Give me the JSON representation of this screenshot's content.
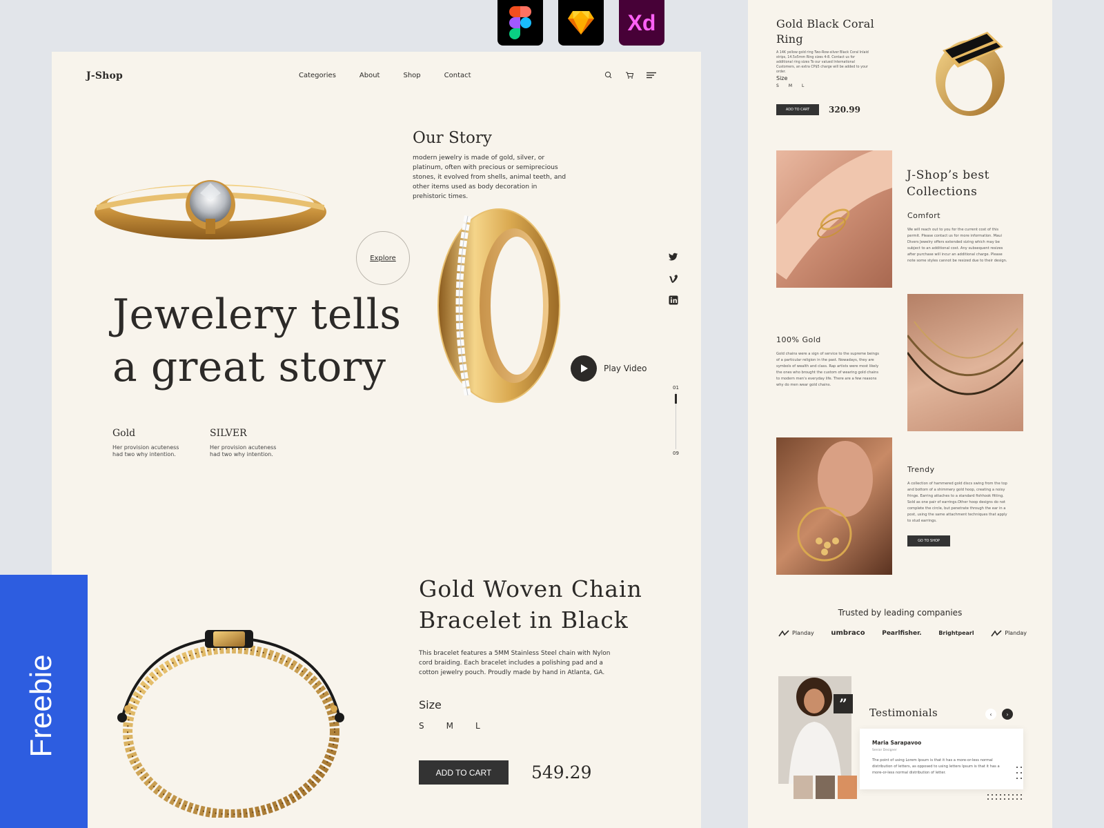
{
  "tools": {
    "xd_label": "Xd"
  },
  "freebie": {
    "label": "Freebie"
  },
  "nav": {
    "logo": "J-Shop",
    "links": [
      "Categories",
      "About",
      "Shop",
      "Contact"
    ],
    "icons": [
      "search-icon",
      "cart-icon",
      "menu-icon"
    ]
  },
  "hero": {
    "story_title": "Our Story",
    "story_text": "modern jewelry is made of gold, silver, or platinum, often with precious or semiprecious stones, it evolved from shells, animal teeth, and other items used as body decoration in prehistoric times.",
    "explore_label": "Explore",
    "title_line1": "Jewelery tells",
    "title_line2": "a great story",
    "materials": [
      {
        "title": "Gold",
        "text": "Her provision acuteness had two why intention."
      },
      {
        "title": "SILVER",
        "text": "Her provision acuteness had two why intention."
      }
    ],
    "play_label": "Play Video",
    "slide_current": "01",
    "slide_total": "09",
    "social_icons": [
      "twitter-icon",
      "vimeo-icon",
      "linkedin-icon"
    ]
  },
  "product": {
    "title_line1": "Gold Woven Chain",
    "title_line2": "Bracelet in Black",
    "description": "This bracelet features a 5MM Stainless Steel chain with Nylon cord braiding. Each bracelet includes a polishing pad and a cotton jewelry pouch. Proudly made by hand in Atlanta, GA.",
    "size_label": "Size",
    "sizes": [
      "S",
      "M",
      "L"
    ],
    "cart_label": "ADD TO CART",
    "price": "549.29"
  },
  "right": {
    "product_title_line1": "Gold Black Coral",
    "product_title_line2": "Ring",
    "product_text": "A 14K yellow gold ring Two-Row-silver Black Coral Inlaid strips, 14.5x5mm Ring sizes 4-8. Contact us for additional ring sizes To our valued International Customers, an extra CP$5 charge will be added to your order.",
    "size_label": "Size",
    "sizes": [
      "S",
      "M",
      "L"
    ],
    "cart_label": "ADD TO CART",
    "price": "320.99",
    "collections_title_line1": "J-Shop’s best",
    "collections_title_line2": "Collections",
    "comfort_title": "Comfort",
    "comfort_text": "We will reach out to you for the current cost of this permit. Please contact us for more information. Maui Divers Jewelry offers extended sizing which may be subject to an additional cost. Any subsequent resizes after purchase will incur an additional charge. Please note some styles cannot be resized due to their design.",
    "gold_title": "100% Gold",
    "gold_text": "Gold chains were a sign of service to the supreme beings of a particular religion in the past. Nowadays, they are symbols of wealth and class. Rap artists were most likely the ones who brought the custom of wearing gold chains to modern men's everyday life. There are a few reasons why do men wear gold chains.",
    "trendy_title": "Trendy",
    "trendy_text": "A collection of hammered gold discs swing from the top and bottom of a shimmery gold hoop, creating a noisy fringe. Earring attaches to a standard fishhook fitting. Sold as one pair of earrings.Other hoop designs do not complete the circle, but penetrate through the ear in a post, using the same attachment techniques that apply to stud earrings.",
    "shop_label": "GO TO SHOP",
    "trusted_title": "Trusted by leading companies",
    "companies": [
      "Planday",
      "umbraco",
      "Pearlfisher.",
      "Brightpearl",
      "Planday"
    ],
    "testimonials_title": "Testimonials",
    "reviewer_name": "Maria Sarapavoo",
    "reviewer_role": "Senior Designer",
    "review_text": "The point of using Lorem Ipsum is that it has a more-or-less normal distribution of letters, as opposed to using letters Ipsum is that it has a more-or-less normal distribution of letter."
  },
  "colors": {
    "background": "#e2e5ea",
    "panel": "#f8f4ec",
    "dark": "#2c2a28",
    "freebie": "#2d5de0",
    "gold": "#d9a84f"
  }
}
